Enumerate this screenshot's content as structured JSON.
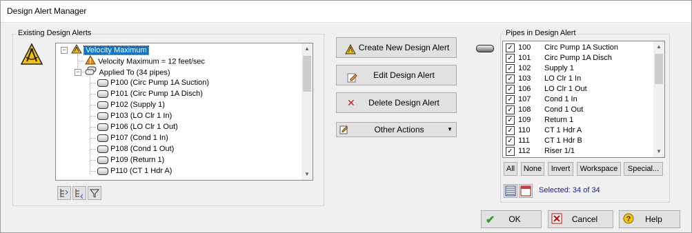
{
  "window": {
    "title": "Design Alert Manager"
  },
  "existing": {
    "label": "Existing Design Alerts",
    "tree": {
      "root": "Velocity Maximum",
      "criterion": "Velocity Maximum = 12 feet/sec",
      "applied": "Applied To (34 pipes)",
      "pipes": [
        "P100 (Circ Pump 1A Suction)",
        "P101 (Circ Pump 1A Disch)",
        "P102 (Supply 1)",
        "P103 (LO Clr 1 In)",
        "P106 (LO Clr 1 Out)",
        "P107 (Cond 1 In)",
        "P108 (Cond 1 Out)",
        "P109 (Return 1)",
        "P110 (CT 1 Hdr A)"
      ]
    }
  },
  "actions": {
    "create": "Create New Design Alert",
    "edit": "Edit Design Alert",
    "delete": "Delete Design Alert",
    "other": "Other Actions"
  },
  "pipes_panel": {
    "label": "Pipes in Design Alert",
    "rows": [
      {
        "num": "100",
        "name": "Circ Pump 1A Suction"
      },
      {
        "num": "101",
        "name": "Circ Pump 1A Disch"
      },
      {
        "num": "102",
        "name": "Supply 1"
      },
      {
        "num": "103",
        "name": "LO Clr 1 In"
      },
      {
        "num": "106",
        "name": "LO Clr 1 Out"
      },
      {
        "num": "107",
        "name": "Cond 1 In"
      },
      {
        "num": "108",
        "name": "Cond 1 Out"
      },
      {
        "num": "109",
        "name": "Return 1"
      },
      {
        "num": "110",
        "name": "CT 1 Hdr A"
      },
      {
        "num": "111",
        "name": "CT 1 Hdr B"
      },
      {
        "num": "112",
        "name": "Riser 1/1"
      }
    ],
    "buttons": {
      "all": "All",
      "none": "None",
      "invert": "Invert",
      "workspace": "Workspace",
      "special": "Special..."
    },
    "selected": "Selected: 34 of 34"
  },
  "footer": {
    "ok": "OK",
    "cancel": "Cancel",
    "help": "Help"
  },
  "colors": {
    "accent": "#0078d7",
    "selected_text": "#1a1a8c",
    "ok_green": "#2e9e2e",
    "cancel_red": "#d11"
  }
}
